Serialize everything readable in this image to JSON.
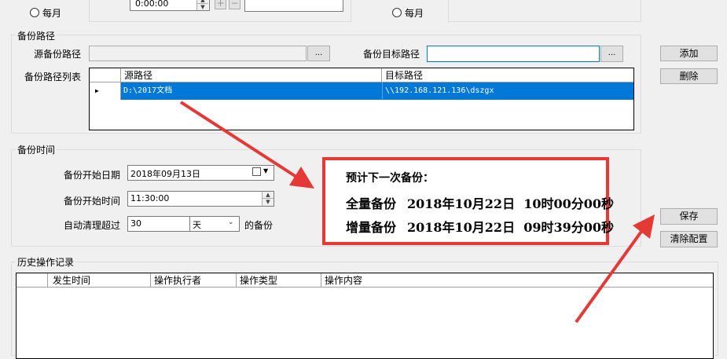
{
  "top": {
    "monthly_left": "每月",
    "monthly_right": "每月",
    "time_value": "0:00:00"
  },
  "backup_path": {
    "group_title": "备份路径",
    "source_label": "源备份路径",
    "source_value": "",
    "browse_label": "...",
    "target_label": "备份目标路径",
    "target_value": "",
    "list_label": "备份路径列表",
    "columns": [
      "源路径",
      "目标路径"
    ],
    "rows": [
      {
        "source": "D:\\2017文档",
        "target": "\\\\192.168.121.136\\dszgx"
      }
    ]
  },
  "side_buttons": {
    "add": "添加",
    "delete": "删除",
    "save": "保存",
    "clear": "清除配置"
  },
  "backup_time": {
    "group_title": "备份时间",
    "start_date_label": "备份开始日期",
    "start_date_value": "2018年09月13日",
    "start_time_label": "备份开始时间",
    "start_time_value": "11:30:00",
    "auto_clean_label": "自动清理超过",
    "auto_clean_value": "30",
    "unit_value": "天",
    "suffix_label": "的备份"
  },
  "next_backup": {
    "title": "预计下一次备份：",
    "full_label": "全量备份",
    "full_value": "2018年10月22日  10时00分00秒",
    "incr_label": "增量备份",
    "incr_value": "2018年10月22日  09时39分00秒"
  },
  "history": {
    "group_title": "历史操作记录",
    "columns": [
      "发生时间",
      "操作执行者",
      "操作类型",
      "操作内容"
    ]
  },
  "colors": {
    "accent": "#0078d7",
    "annotation_red": "#e53935"
  }
}
